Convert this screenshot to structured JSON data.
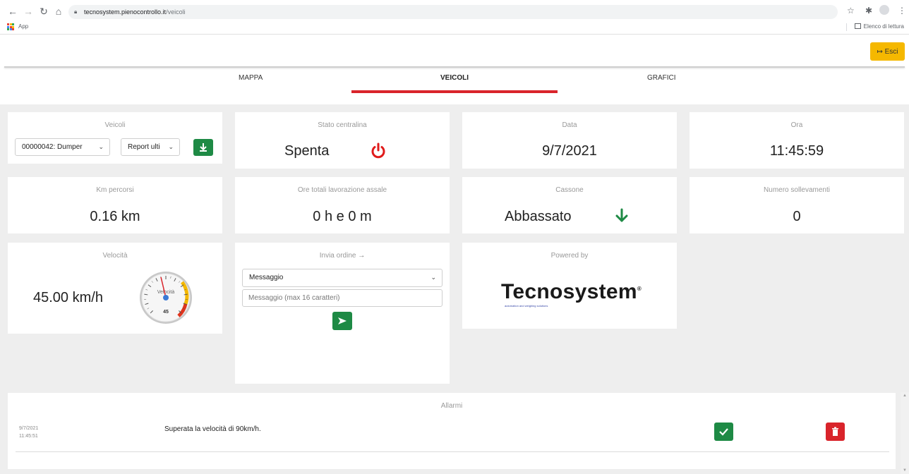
{
  "browser": {
    "url_host": "tecnosystem.pienocontrollo.it",
    "url_path": "/veicoli",
    "bookmarks_apps": "App",
    "reading_list": "Elenco di lettura"
  },
  "header": {
    "logout_label": "Esci"
  },
  "tabs": [
    {
      "label": "MAPPA",
      "active": false
    },
    {
      "label": "VEICOLI",
      "active": true
    },
    {
      "label": "GRAFICI",
      "active": false
    }
  ],
  "cards": {
    "veicoli": {
      "title": "Veicoli",
      "vehicle_select": "00000042: Dumper",
      "report_select": "Report ulti"
    },
    "stato": {
      "title": "Stato centralina",
      "value": "Spenta"
    },
    "data": {
      "title": "Data",
      "value": "9/7/2021"
    },
    "ora": {
      "title": "Ora",
      "value": "11:45:59"
    },
    "km": {
      "title": "Km percorsi",
      "value": "0.16 km"
    },
    "ore": {
      "title": "Ore totali lavorazione assale",
      "value": "0 h e 0 m"
    },
    "cassone": {
      "title": "Cassone",
      "value": "Abbassato"
    },
    "sollevamenti": {
      "title": "Numero sollevamenti",
      "value": "0"
    },
    "velocita": {
      "title": "Velocità",
      "value": "45.00 km/h",
      "gauge_label": "Velocità",
      "gauge_readout": "45",
      "gauge_value": 45,
      "gauge_max": 100
    },
    "ordine": {
      "title": "Invia ordine",
      "select_value": "Messaggio",
      "input_placeholder": "Messaggio (max 16 caratteri)"
    },
    "powered": {
      "title": "Powered by",
      "logo_text": "Tecnosystem",
      "logo_sub": "automation and weighing solutions"
    }
  },
  "alarms": {
    "title": "Allarmi",
    "items": [
      {
        "date": "9/7/2021",
        "time": "11:45:51",
        "message": "Superata la velocità di 90km/h."
      }
    ]
  },
  "colors": {
    "accent_red": "#d9242b",
    "accent_green": "#1e8a45",
    "accent_yellow": "#f5b800"
  }
}
